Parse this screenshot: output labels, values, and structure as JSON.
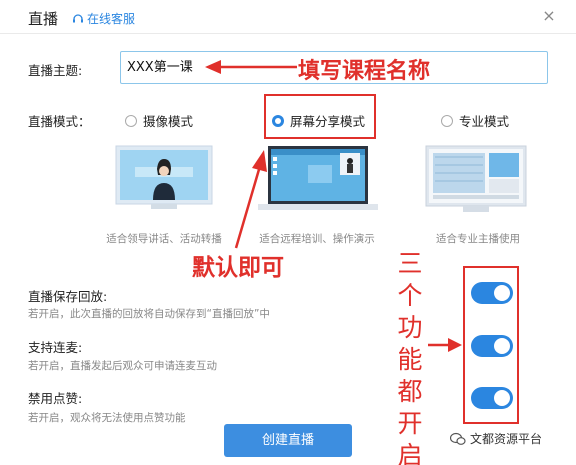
{
  "header": {
    "title": "直播",
    "service": "在线客服",
    "close": "×"
  },
  "topic": {
    "label": "直播主题:",
    "value": "XXX第一课"
  },
  "annotations": {
    "fill": "填写课程名称",
    "default": "默认即可",
    "vertical": [
      "三",
      "个",
      "功",
      "能",
      "都",
      "开",
      "启"
    ]
  },
  "mode": {
    "label": "直播模式：",
    "options": [
      {
        "label": "摄像模式",
        "desc": "适合领导讲话、活动转播",
        "selected": false
      },
      {
        "label": "屏幕分享模式",
        "desc": "适合远程培训、操作演示",
        "selected": true
      },
      {
        "label": "专业模式",
        "desc": "适合专业主播使用",
        "selected": false
      }
    ]
  },
  "settings": [
    {
      "title": "直播保存回放:",
      "desc": "若开启，此次直播的回放将自动保存到“直播回放”中",
      "on": true
    },
    {
      "title": "支持连麦:",
      "desc": "若开启，直播发起后观众可申请连麦互动",
      "on": true
    },
    {
      "title": "禁用点赞:",
      "desc": "若开启，观众将无法使用点赞功能",
      "on": true
    }
  ],
  "create_label": "创建直播",
  "watermark": "文都资源平台",
  "colors": {
    "accent": "#2b86e0",
    "annotation": "#e0302b"
  }
}
